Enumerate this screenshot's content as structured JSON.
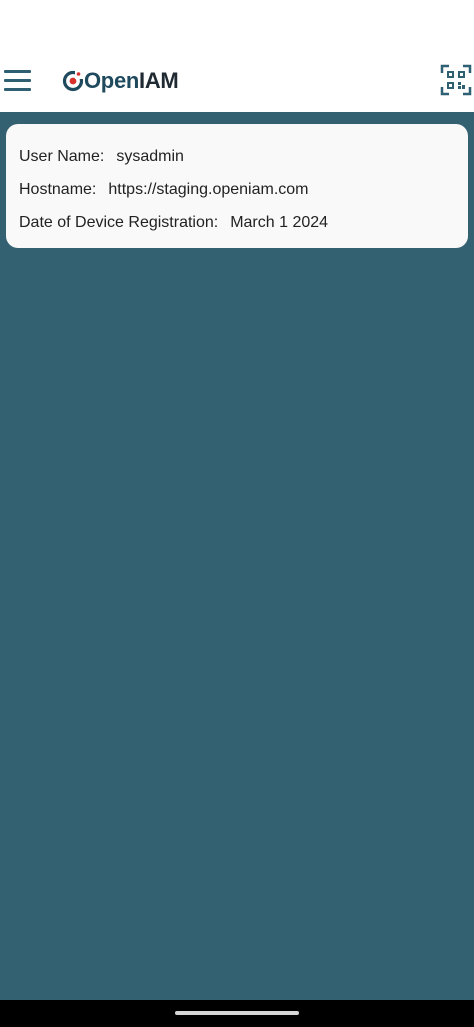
{
  "app_bar": {
    "logo_open": "Open",
    "logo_iam": "IAM",
    "menu_icon": "hamburger-menu-icon",
    "qr_icon": "qr-code-scan-icon"
  },
  "device_info": {
    "username_label": "User Name:",
    "username_value": "sysadmin",
    "hostname_label": "Hostname:",
    "hostname_value": "https://staging.openiam.com",
    "registration_label": "Date of Device Registration:",
    "registration_value": "March 1 2024"
  },
  "colors": {
    "accent": "#336172",
    "logo_dot": "#d9312b",
    "card_background": "#f9f9f9"
  }
}
